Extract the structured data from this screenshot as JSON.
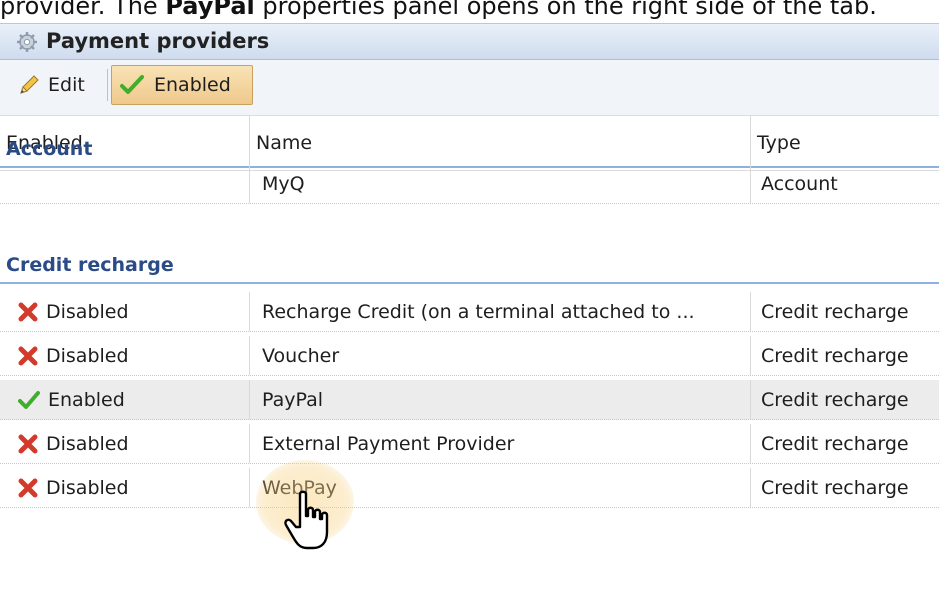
{
  "intro": {
    "text_before": "provider. The ",
    "text_bold": "PayPal",
    "text_after": " properties panel opens on the right side of the tab."
  },
  "panel": {
    "title": "Payment providers"
  },
  "toolbar": {
    "edit_label": "Edit",
    "enabled_label": "Enabled"
  },
  "columns": [
    "Enabled",
    "Name",
    "Type"
  ],
  "groups": [
    {
      "label": "Account",
      "rows": [
        {
          "status": "",
          "name": "MyQ",
          "type": "Account"
        }
      ]
    },
    {
      "label": "Credit recharge",
      "rows": [
        {
          "status": "Disabled",
          "name": "Recharge Credit (on a terminal attached to ...",
          "type": "Credit recharge"
        },
        {
          "status": "Disabled",
          "name": "Voucher",
          "type": "Credit recharge"
        },
        {
          "status": "Enabled",
          "name": "PayPal",
          "type": "Credit recharge",
          "selected": true
        },
        {
          "status": "Disabled",
          "name": "External Payment Provider",
          "type": "Credit recharge"
        },
        {
          "status": "Disabled",
          "name": "WebPay",
          "type": "Credit recharge"
        }
      ]
    }
  ],
  "icons": {
    "edit": "pencil-icon",
    "enabled": "checkmark-icon",
    "disabled": "red-x-icon",
    "panel": "gear-icon"
  },
  "colors": {
    "group_text": "#2a4b86",
    "enabled_check": "#3fae2a",
    "disabled_x": "#d23b2b"
  }
}
